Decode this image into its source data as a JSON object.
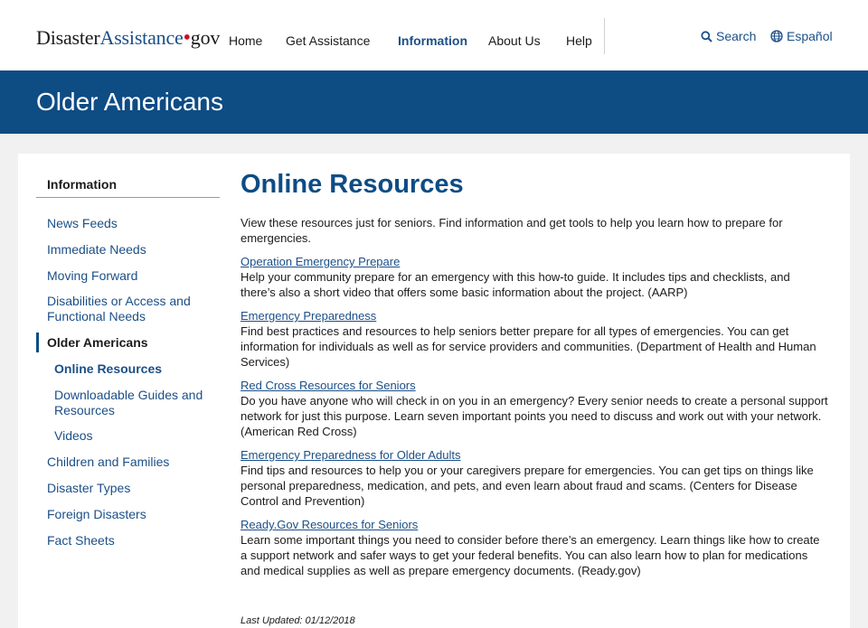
{
  "header": {
    "logo": {
      "part1": "Disaster",
      "part2": "Assistance",
      "dot": "•",
      "part3": "gov"
    },
    "nav": [
      "Home",
      "Get Assistance",
      "Information",
      "About Us",
      "Help"
    ],
    "search_label": "Search",
    "language_label": "Español"
  },
  "banner": {
    "title": "Older Americans"
  },
  "sidebar": {
    "heading": "Information",
    "items": [
      "News Feeds",
      "Immediate Needs",
      "Moving Forward",
      "Disabilities or Access and Functional Needs",
      "Older Americans",
      "Online Resources",
      "Downloadable Guides and Resources",
      "Videos",
      "Children and Families",
      "Disaster Types",
      "Foreign Disasters",
      "Fact Sheets"
    ]
  },
  "main": {
    "title": "Online Resources",
    "intro": "View these resources just for seniors. Find information and get tools to help you learn how to prepare for emergencies.",
    "resources": [
      {
        "title": "Operation Emergency Prepare",
        "desc": "Help your community prepare for an emergency with this how-to guide. It includes tips and checklists, and there’s also a short video that offers some basic information about the project. (AARP)"
      },
      {
        "title": "Emergency Preparedness",
        "desc": "Find best practices and resources to help seniors better prepare for all types of emergencies. You can get information for individuals as well as for service providers and communities. (Department of Health and Human Services)"
      },
      {
        "title": "Red Cross Resources for Seniors",
        "desc": "Do you have anyone who will check in on you in an emergency? Every senior needs to create a personal support network for just this purpose. Learn seven important points you need to discuss and work out with your network. (American Red Cross)"
      },
      {
        "title": "Emergency Preparedness for Older Adults",
        "desc": "Find tips and resources to help you or your caregivers prepare for emergencies. You can get tips on things like personal preparedness, medication, and pets, and even learn about fraud and scams. (Centers for Disease Control and Prevention)"
      },
      {
        "title": "Ready.Gov Resources for Seniors",
        "desc": "Learn some important things you need to consider before there’s an emergency. Learn things like how to create a support network and safer ways to get your federal benefits. You can also learn how to plan for medications and medical supplies as well as prepare emergency documents. (Ready.gov)"
      }
    ],
    "last_updated": "Last Updated: 01/12/2018"
  },
  "colors": {
    "brand": "#0e4c84",
    "link": "#1b4f87",
    "logo_dot": "#c8102e"
  },
  "icons": {
    "search": "search-icon",
    "language": "globe-icon"
  }
}
